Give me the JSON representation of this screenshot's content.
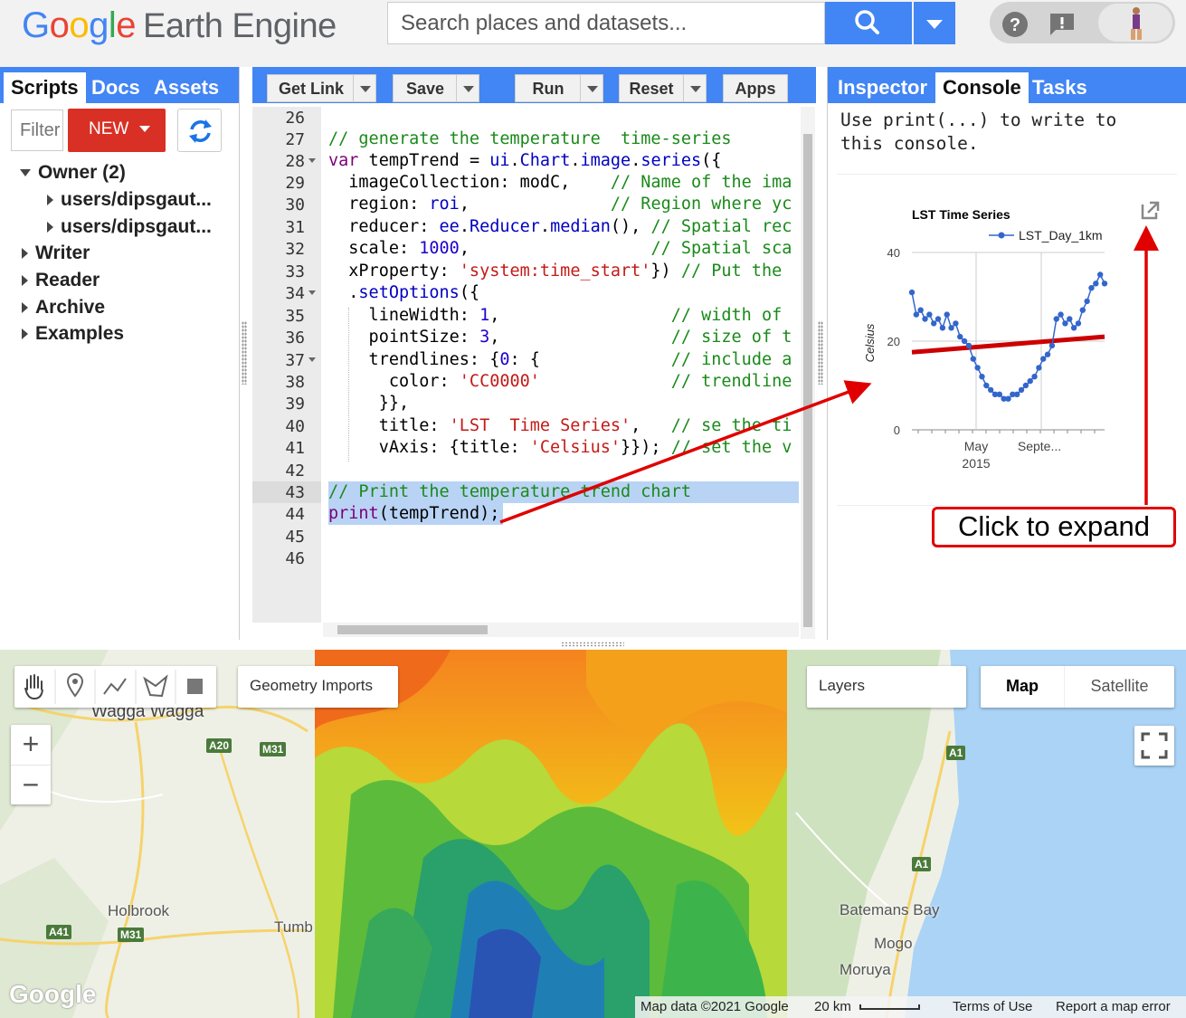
{
  "header": {
    "logo_google": "Google",
    "logo_product": "Earth Engine",
    "search_placeholder": "Search places and datasets...",
    "icons": [
      "search-icon",
      "chevron-down-icon",
      "help-icon",
      "feedback-icon",
      "avatar"
    ]
  },
  "left_panel": {
    "tabs": [
      "Scripts",
      "Docs",
      "Assets"
    ],
    "active_tab": "Scripts",
    "filter_placeholder": "Filter scripts",
    "new_button": "NEW",
    "tree": [
      {
        "label": "Owner (2)",
        "expanded": true,
        "level": 0
      },
      {
        "label": "users/dipsgaut...",
        "expanded": false,
        "level": 1
      },
      {
        "label": "users/dipsgaut...",
        "expanded": false,
        "level": 1
      },
      {
        "label": "Writer",
        "expanded": false,
        "level": 0
      },
      {
        "label": "Reader",
        "expanded": false,
        "level": 0
      },
      {
        "label": "Archive",
        "expanded": false,
        "level": 0
      },
      {
        "label": "Examples",
        "expanded": false,
        "level": 0
      }
    ]
  },
  "toolbar": {
    "get_link": "Get Link",
    "save": "Save",
    "run": "Run",
    "reset": "Reset",
    "apps": "Apps"
  },
  "editor": {
    "line_numbers": [
      "26",
      "27",
      "28",
      "29",
      "30",
      "31",
      "32",
      "33",
      "34",
      "35",
      "36",
      "37",
      "38",
      "39",
      "40",
      "41",
      "42",
      "43",
      "44",
      "45",
      "46"
    ],
    "lines": [
      "",
      "// generate the temperature  time-series",
      "var tempTrend = ui.Chart.image.series({",
      "  imageCollection: modC,    // Name of the ima",
      "  region: roi,              // Region where yc",
      "  reducer: ee.Reducer.median(), // Spatial rec",
      "  scale: 1000,                  // Spatial sca",
      "  xProperty: 'system:time_start'}) // Put the ",
      "  .setOptions({",
      "    lineWidth: 1,                 // width of ",
      "    pointSize: 3,                 // size of t",
      "    trendlines: {0: {             // include a",
      "      color: 'CC0000'             // trendline",
      "     }},",
      "     title: 'LST  Time Series',   // se the ti",
      "     vAxis: {title: 'Celsius'}}); // set the v",
      "",
      "// Print the temperature trend chart",
      "print(tempTrend);",
      "",
      ""
    ],
    "selected_line": "43"
  },
  "right_panel": {
    "tabs": [
      "Inspector",
      "Console",
      "Tasks"
    ],
    "active_tab": "Console",
    "console_hint": "Use print(...) to write to\nthis console."
  },
  "chart_data": {
    "type": "line",
    "title": "LST Time Series",
    "xlabel": "",
    "ylabel": "Celsius",
    "ylim": [
      0,
      40
    ],
    "y_ticks": [
      "0",
      "20",
      "40"
    ],
    "x_tick_labels": [
      "May",
      "Septe..."
    ],
    "x_tick_sublabel": "2015",
    "legend": "top-right",
    "series": [
      {
        "name": "LST_Day_1km",
        "color": "#3366cc",
        "values": [
          31,
          26,
          27,
          25,
          26,
          24,
          25,
          23,
          26,
          23,
          24,
          21,
          20,
          19,
          16,
          14,
          12,
          10,
          9,
          8,
          8,
          7,
          7,
          8,
          8,
          9,
          10,
          11,
          12,
          14,
          16,
          17,
          19,
          25,
          26,
          24,
          25,
          23,
          24,
          27,
          29,
          32,
          33,
          35,
          33
        ]
      }
    ],
    "trendline": {
      "color": "#cc0000",
      "start": 17.5,
      "end": 21
    }
  },
  "annotation": {
    "callout": "Click to expand",
    "arrow_color": "#e00000"
  },
  "map": {
    "drawing_tools": [
      "hand-icon",
      "point-icon",
      "line-icon",
      "polygon-icon",
      "rectangle-icon"
    ],
    "geometry_imports": "Geometry Imports",
    "layers": "Layers",
    "map_type_map": "Map",
    "map_type_satellite": "Satellite",
    "zoom_in": "+",
    "zoom_out": "−",
    "places": [
      "Wagga Wagga",
      "Holbrook",
      "Tumb",
      "Batemans Bay",
      "Mogo",
      "Moruya"
    ],
    "road_shields": [
      "A20",
      "M31",
      "A41",
      "M31",
      "A1",
      "A1"
    ],
    "footer": {
      "map_data": "Map data ©2021 Google",
      "scale": "20 km",
      "terms": "Terms of Use",
      "report": "Report a map error",
      "google_logo": "Google"
    }
  }
}
